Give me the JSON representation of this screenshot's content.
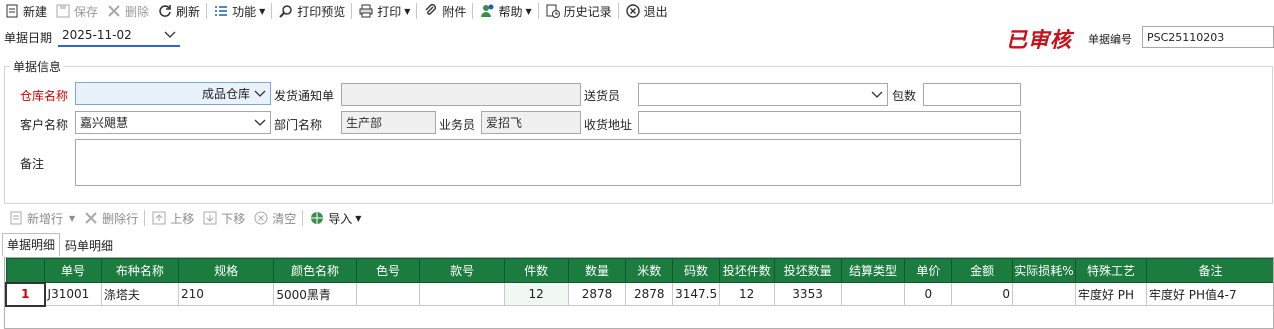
{
  "toolbar": {
    "new": "新建",
    "save": "保存",
    "delete": "删除",
    "refresh": "刷新",
    "function": "功能",
    "print_preview": "打印预览",
    "print": "打印",
    "attachment": "附件",
    "help": "帮助",
    "history": "历史记录",
    "exit": "退出"
  },
  "header": {
    "date_label": "单据日期",
    "date_value": "2025-11-02",
    "status_stamp": "已审核",
    "doc_no_label": "单据编号",
    "doc_no_value": "PSC25110203"
  },
  "info": {
    "title": "单据信息",
    "warehouse_label": "仓库名称",
    "warehouse_value": "成品仓库",
    "delivery_notice_label": "发货通知单",
    "delivery_notice_value": "",
    "courier_label": "送货员",
    "courier_value": "",
    "packages_label": "包数",
    "packages_value": "",
    "customer_label": "客户名称",
    "customer_value": "嘉兴飓慧",
    "department_label": "部门名称",
    "department_value": "生产部",
    "salesman_label": "业务员",
    "salesman_value": "爱招飞",
    "address_label": "收货地址",
    "address_value": "",
    "remark_label": "备注",
    "remark_value": ""
  },
  "detail_toolbar": {
    "add_row": "新增行",
    "delete_row": "删除行",
    "move_up": "上移",
    "move_down": "下移",
    "clear": "清空",
    "import": "导入"
  },
  "tabs": [
    "单据明细",
    "码单明细"
  ],
  "grid": {
    "columns": [
      "",
      "单号",
      "布种名称",
      "规格",
      "颜色名称",
      "色号",
      "款号",
      "件数",
      "数量",
      "米数",
      "码数",
      "投坯件数",
      "投坯数量",
      "结算类型",
      "单价",
      "金额",
      "实际损耗%",
      "特殊工艺",
      "备注"
    ],
    "rows": [
      [
        "1",
        "J31001",
        "涤塔夫",
        "210",
        "5000黑青",
        "",
        "",
        "12",
        "2878",
        "2878",
        "3147.5",
        "12",
        "3353",
        "",
        "0",
        "0",
        "",
        "牢度好 PH",
        "牢度好 PH值4-7"
      ]
    ]
  },
  "colors": {
    "header_green": "#1c7b3f",
    "required_red": "#d40000",
    "stamp_red": "#c8101a"
  }
}
